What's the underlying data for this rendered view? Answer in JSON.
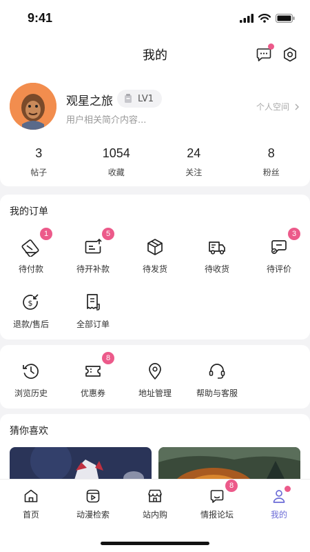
{
  "status_bar": {
    "time": "9:41"
  },
  "header": {
    "title": "我的"
  },
  "profile": {
    "username": "观星之旅",
    "level": "LV1",
    "bio": "用户相关简介内容...",
    "space_link": "个人空间",
    "stats": [
      {
        "value": "3",
        "label": "帖子"
      },
      {
        "value": "1054",
        "label": "收藏"
      },
      {
        "value": "24",
        "label": "关注"
      },
      {
        "value": "8",
        "label": "粉丝"
      }
    ]
  },
  "orders": {
    "title": "我的订单",
    "items": [
      {
        "label": "待付款",
        "icon": "wallet-icon",
        "badge": "1"
      },
      {
        "label": "待开补款",
        "icon": "invoice-icon",
        "badge": "5"
      },
      {
        "label": "待发货",
        "icon": "package-icon",
        "badge": ""
      },
      {
        "label": "待收货",
        "icon": "truck-icon",
        "badge": ""
      },
      {
        "label": "待评价",
        "icon": "review-icon",
        "badge": "3"
      },
      {
        "label": "退款/售后",
        "icon": "refund-icon",
        "badge": ""
      },
      {
        "label": "全部订单",
        "icon": "receipt-icon",
        "badge": ""
      }
    ]
  },
  "services": {
    "items": [
      {
        "label": "浏览历史",
        "icon": "history-icon",
        "badge": ""
      },
      {
        "label": "优惠券",
        "icon": "coupon-icon",
        "badge": "8"
      },
      {
        "label": "地址管理",
        "icon": "location-icon",
        "badge": ""
      },
      {
        "label": "帮助与客服",
        "icon": "headset-icon",
        "badge": ""
      }
    ]
  },
  "recommend": {
    "title": "猜你喜欢"
  },
  "tabbar": {
    "items": [
      {
        "label": "首页",
        "icon": "home-icon",
        "badge": ""
      },
      {
        "label": "动漫检索",
        "icon": "anime-search-icon",
        "badge": ""
      },
      {
        "label": "站内购",
        "icon": "shop-icon",
        "badge": ""
      },
      {
        "label": "情报论坛",
        "icon": "forum-icon",
        "badge": "8"
      },
      {
        "label": "我的",
        "icon": "profile-icon",
        "badge": ""
      }
    ],
    "active_index": 4
  },
  "colors": {
    "accent": "#ec5a8a",
    "active_tab": "#6b6bd6",
    "background": "#f3f3f5"
  }
}
